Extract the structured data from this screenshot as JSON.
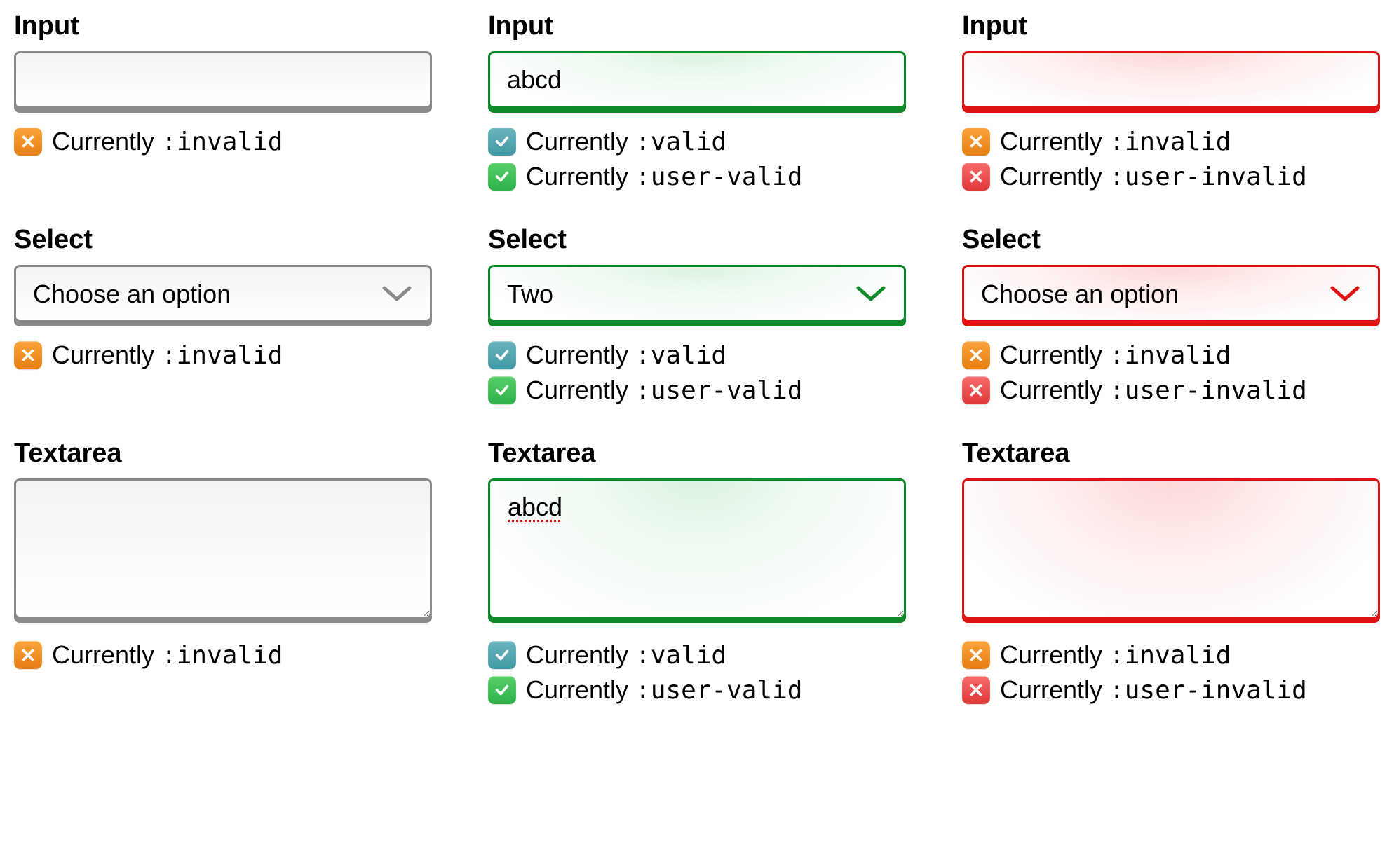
{
  "labels": {
    "input": "Input",
    "select": "Select",
    "textarea": "Textarea",
    "currently": "Currently "
  },
  "pseudo": {
    "invalid": ":invalid",
    "valid": ":valid",
    "user_valid": ":user-valid",
    "user_invalid": ":user-invalid"
  },
  "input": {
    "col1": {
      "value": ""
    },
    "col2": {
      "value": "abcd"
    },
    "col3": {
      "value": ""
    }
  },
  "select": {
    "placeholder": "Choose an option",
    "col1": {
      "value": "Choose an option"
    },
    "col2": {
      "value": "Two"
    },
    "col3": {
      "value": "Choose an option"
    }
  },
  "textarea": {
    "col1": {
      "value": ""
    },
    "col2": {
      "value": "abcd"
    },
    "col3": {
      "value": ""
    }
  },
  "colors": {
    "grey": "#8a8a8a",
    "green": "#0f8a2a",
    "red": "#e01212"
  }
}
